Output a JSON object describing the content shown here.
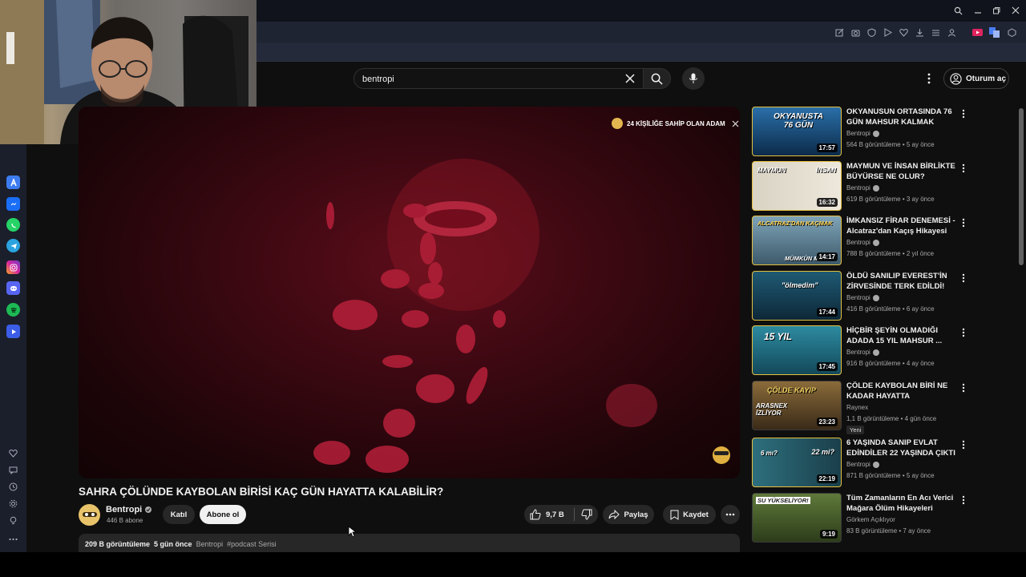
{
  "search": {
    "value": "bentropi"
  },
  "header": {
    "signin_label": "Oturum aç"
  },
  "video": {
    "banner": "24 KİŞİLİĞE SAHİP OLAN ADAM",
    "title": "SAHRA ÇÖLÜNDE KAYBOLAN BİRİSİ KAÇ GÜN HAYATTA KALABİLİR?",
    "channel": "Bentropi",
    "subscribers": "446 B abone",
    "join_label": "Katıl",
    "subscribe_label": "Abone ol",
    "likes": "9,7 B",
    "share_label": "Paylaş",
    "save_label": "Kaydet",
    "views": "209 B görüntüleme",
    "age": "5 gün önce",
    "desc_channel": "Bentropi",
    "hashtag": "#podcast Serisi"
  },
  "suggestions": [
    {
      "title": "OKYANUSUN ORTASINDA 76 GÜN MAHSUR KALMAK",
      "channel": "Bentropi",
      "views": "564 B görüntüleme",
      "age": "5 ay önce",
      "duration": "17:57",
      "thumb_text": "OKYANUSTA 76 GÜN"
    },
    {
      "title": "MAYMUN VE İNSAN BİRLİKTE BÜYÜRSE NE OLUR?",
      "channel": "Bentropi",
      "views": "619 B görüntüleme",
      "age": "3 ay önce",
      "duration": "16:32",
      "thumb_text_left": "MAYMUN",
      "thumb_text_right": "İNSAN"
    },
    {
      "title": "İMKANSIZ FİRAR DENEMESİ - Alcatraz'dan Kaçış Hikayesi",
      "channel": "Bentropi",
      "views": "788 B görüntüleme",
      "age": "2 yıl önce",
      "duration": "14:17",
      "thumb_text": "ALCATRAZ'DAN KAÇMAK",
      "thumb_text_2": "MÜMKÜN MÜ?"
    },
    {
      "title": "ÖLDÜ SANILIP EVEREST'İN ZİRVESİNDE TERK EDİLDİ!",
      "channel": "Bentropi",
      "views": "416 B görüntüleme",
      "age": "6 ay önce",
      "duration": "17:44",
      "thumb_text": "\"ölmedim\""
    },
    {
      "title": "HİÇBİR ŞEYİN OLMADIĞI ADADA 15 YIL MAHSUR ...",
      "channel": "Bentropi",
      "views": "916 B görüntüleme",
      "age": "4 ay önce",
      "duration": "17:45",
      "thumb_text": "15 YIL"
    },
    {
      "title": "ÇÖLDE KAYBOLAN BİRİ NE KADAR HAYATTA KALABİLİR!?...",
      "channel": "Raynex",
      "views": "1,1 B görüntüleme",
      "age": "4 gün önce",
      "duration": "23:23",
      "thumb_text": "ÇÖLDE KAYIP",
      "thumb_text_2": "ARASNEX İZLİYOR",
      "badge": "Yeni"
    },
    {
      "title": "6 YAŞINDA SANIP EVLAT EDİNDİLER 22 YAŞINDA ÇIKTI",
      "channel": "Bentropi",
      "views": "871 B görüntüleme",
      "age": "5 ay önce",
      "duration": "22:19",
      "thumb_text_left": "6 mı?",
      "thumb_text_right": "22 mi?"
    },
    {
      "title": "Tüm Zamanların En Acı Verici Mağara Ölüm Hikayeleri",
      "channel": "Görkem Açıklıyor",
      "views": "83 B görüntüleme",
      "age": "7 ay önce",
      "duration": "9:19",
      "thumb_text": "SU YÜKSELİYOR!"
    }
  ]
}
